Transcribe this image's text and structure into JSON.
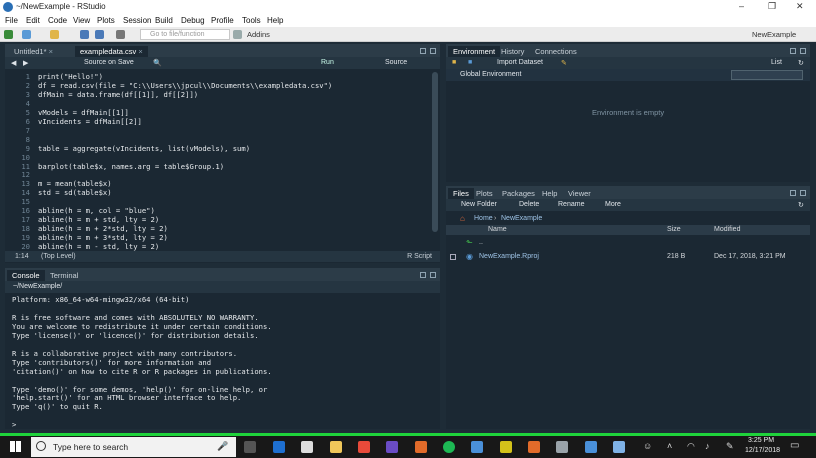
{
  "window": {
    "title": "~/NewExample - RStudio",
    "minimize": "–",
    "maximize": "❐",
    "close": "✕"
  },
  "menu": [
    "File",
    "Edit",
    "Code",
    "View",
    "Plots",
    "Session",
    "Build",
    "Debug",
    "Profile",
    "Tools",
    "Help"
  ],
  "toolbar": {
    "goto_placeholder": "Go to file/function",
    "addins": "Addins",
    "project": "NewExample"
  },
  "editor": {
    "tabs": [
      {
        "label": "Untitled1*"
      },
      {
        "label": "exampledata.csv"
      }
    ],
    "source_on_save": "Source on Save",
    "run": "Run",
    "source": "Source",
    "lines": [
      "print(\"Hello!\")",
      "df = read.csv(file = \"C:\\\\Users\\\\jpcul\\\\Documents\\\\exampledata.csv\")",
      "dfMain = data.frame(df[[1]], df[[2]])",
      "",
      "vModels = dfMain[[1]]",
      "vIncidents = dfMain[[2]]",
      "",
      "",
      "table = aggregate(vIncidents, list(vModels), sum)",
      "",
      "barplot(table$x, names.arg = table$Group.1)",
      "",
      "m = mean(table$x)",
      "std = sd(table$x)",
      "",
      "abline(h = m, col = \"blue\")",
      "abline(h = m + std, lty = 2)",
      "abline(h = m + 2*std, lty = 2)",
      "abline(h = m + 3*std, lty = 2)",
      "abline(h = m - std, lty = 2)"
    ],
    "line_numbers": [
      "1",
      "2",
      "3",
      "4",
      "5",
      "6",
      "7",
      "8",
      "9",
      "10",
      "11",
      "12",
      "13",
      "14",
      "15",
      "16",
      "17",
      "18",
      "19",
      "20"
    ],
    "status_pos": "1:14",
    "status_scope": "(Top Level)",
    "status_type": "R Script"
  },
  "console": {
    "tabs": [
      {
        "label": "Console"
      },
      {
        "label": "Terminal"
      }
    ],
    "path": "~/NewExample/",
    "lines": [
      "Platform: x86_64-w64-mingw32/x64 (64-bit)",
      "",
      "R is free software and comes with ABSOLUTELY NO WARRANTY.",
      "You are welcome to redistribute it under certain conditions.",
      "Type 'license()' or 'licence()' for distribution details.",
      "",
      "R is a collaborative project with many contributors.",
      "Type 'contributors()' for more information and",
      "'citation()' on how to cite R or R packages in publications.",
      "",
      "Type 'demo()' for some demos, 'help()' for on-line help, or",
      "'help.start()' for an HTML browser interface to help.",
      "Type 'q()' to quit R.",
      "",
      ">"
    ]
  },
  "environment": {
    "tabs": [
      {
        "label": "Environment"
      },
      {
        "label": "History"
      },
      {
        "label": "Connections"
      }
    ],
    "import": "Import Dataset",
    "list": "List",
    "scope": "Global Environment",
    "empty": "Environment is empty"
  },
  "files": {
    "tabs": [
      {
        "label": "Files"
      },
      {
        "label": "Plots"
      },
      {
        "label": "Packages"
      },
      {
        "label": "Help"
      },
      {
        "label": "Viewer"
      }
    ],
    "new_folder": "New Folder",
    "delete": "Delete",
    "rename": "Rename",
    "more": "More",
    "breadcrumb": [
      "Home",
      "NewExample"
    ],
    "columns": {
      "name": "Name",
      "size": "Size",
      "modified": "Modified"
    },
    "rows": [
      {
        "name": "..",
        "size": "",
        "modified": ""
      },
      {
        "name": "NewExample.Rproj",
        "size": "218 B",
        "modified": "Dec 17, 2018, 3:21 PM"
      }
    ]
  },
  "taskbar": {
    "search_placeholder": "Type here to search",
    "time": "3:25 PM",
    "date": "12/17/2018"
  }
}
